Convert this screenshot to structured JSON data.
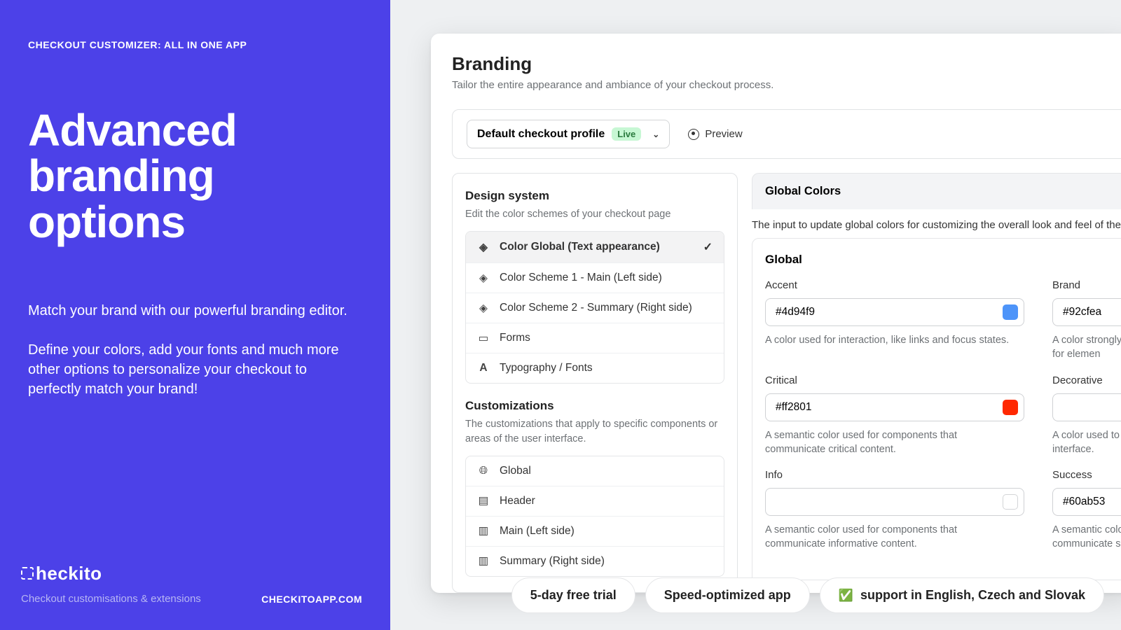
{
  "left": {
    "eyebrow": "CHECKOUT CUSTOMIZER: ALL IN ONE APP",
    "headline": "Advanced branding options",
    "sub1": "Match your brand with our powerful branding editor.",
    "sub2": "Define your colors, add your fonts and much more other options to personalize your checkout to perfectly match your brand!",
    "logo": "heckito",
    "tagline": "Checkout customisations & extensions",
    "site": "CHECKITOAPP.COM"
  },
  "app": {
    "title": "Branding",
    "subtitle": "Tailor the entire appearance and ambiance of your checkout process.",
    "profile_label": "Default checkout profile",
    "profile_badge": "Live",
    "preview": "Preview",
    "design": {
      "title": "Design system",
      "sub": "Edit the color schemes of your checkout page",
      "items": [
        "Color Global (Text appearance)",
        "Color Scheme 1 - Main (Left side)",
        "Color Scheme 2 - Summary (Right side)",
        "Forms",
        "Typography / Fonts"
      ]
    },
    "custom": {
      "title": "Customizations",
      "sub": "The customizations that apply to specific components or areas of the user interface.",
      "items": [
        "Global",
        "Header",
        "Main (Left side)",
        "Summary (Right side)"
      ]
    },
    "colors": {
      "head": "Global Colors",
      "desc": "The input to update global colors for customizing the overall look and feel of the",
      "card_title": "Global",
      "fields": {
        "accent": {
          "label": "Accent",
          "value": "#4d94f9",
          "swatch": "#4d94f9",
          "help": "A color used for interaction, like links and focus states."
        },
        "brand": {
          "label": "Brand",
          "value": "#92cfea",
          "swatch": "#92cfea",
          "help": "A color strongly used for elemen"
        },
        "critical": {
          "label": "Critical",
          "value": "#ff2801",
          "swatch": "#ff2801",
          "help": "A semantic color used for components that communicate critical content."
        },
        "decorative": {
          "label": "Decorative",
          "value": "",
          "swatch": "#ffffff",
          "help": "A color used to h interface."
        },
        "info": {
          "label": "Info",
          "value": "",
          "swatch": "#ffffff",
          "help": "A semantic color used for components that communicate informative content."
        },
        "success": {
          "label": "Success",
          "value": "#60ab53",
          "swatch": "#60ab53",
          "help": "A semantic colo communicate su"
        }
      }
    }
  },
  "pills": {
    "trial": "5-day free trial",
    "speed": "Speed-optimized app",
    "support": "support in English, Czech and Slovak"
  }
}
